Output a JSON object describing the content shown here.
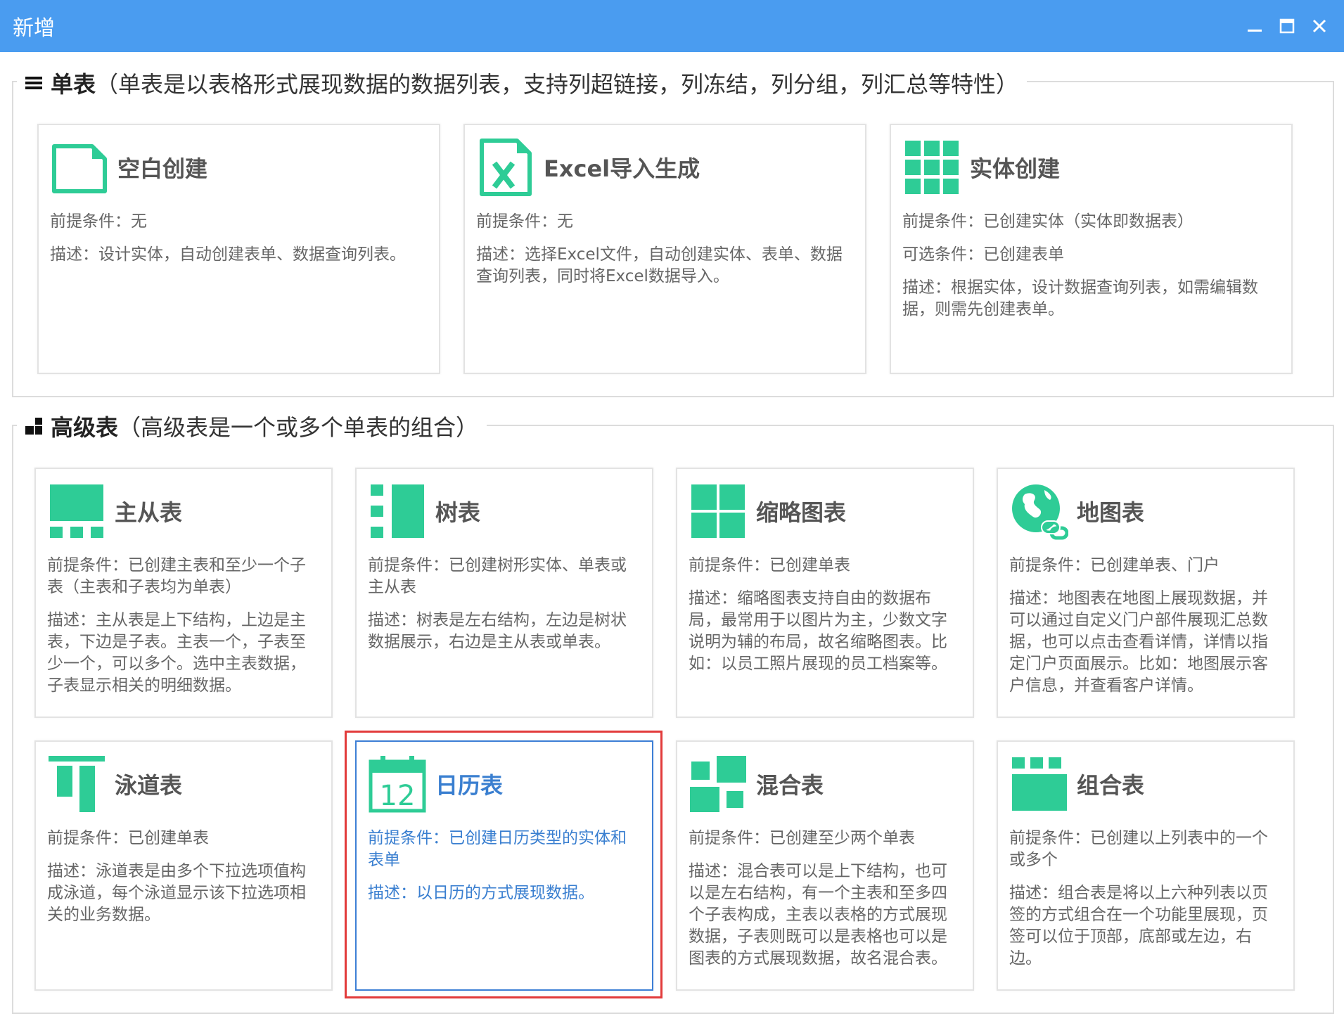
{
  "window": {
    "title": "新增",
    "controls": [
      "minimize-icon",
      "maximize-icon",
      "close-icon"
    ]
  },
  "colors": {
    "titlebar": "#4a9cf0",
    "accent_green": "#2ecc96",
    "selected_blue": "#3a7fd0",
    "selection_red": "#e23b3b"
  },
  "single_table": {
    "name": "单表",
    "desc": "（单表是以表格形式展现数据的数据列表，支持列超链接，列冻结，列分组，列汇总等特性）",
    "icon": "list-icon",
    "cards": [
      {
        "icon": "blank-doc-icon",
        "title": "空白创建",
        "lines": [
          "前提条件：无",
          "描述：设计实体，自动创建表单、数据查询列表。"
        ]
      },
      {
        "icon": "excel-icon",
        "title": "Excel导入生成",
        "lines": [
          "前提条件：无",
          "描述：选择Excel文件，自动创建实体、表单、数据查询列表，同时将Excel数据导入。"
        ]
      },
      {
        "icon": "grid-icon",
        "title": "实体创建",
        "lines": [
          "前提条件：已创建实体（实体即数据表）",
          "可选条件：已创建表单",
          "描述：根据实体，设计数据查询列表，如需编辑数据，则需先创建表单。"
        ]
      }
    ]
  },
  "advanced_table": {
    "name": "高级表",
    "desc": "（高级表是一个或多个单表的组合）",
    "icon": "blocks-icon",
    "cards": [
      {
        "icon": "master-detail-icon",
        "title": "主从表",
        "lines": [
          "前提条件：已创建主表和至少一个子表（主表和子表均为单表）",
          "描述：主从表是上下结构，上边是主表，下边是子表。主表一个，子表至少一个，可以多个。选中主表数据，子表显示相关的明细数据。"
        ]
      },
      {
        "icon": "tree-icon",
        "title": "树表",
        "lines": [
          "前提条件：已创建树形实体、单表或主从表",
          "描述：树表是左右结构，左边是树状数据展示，右边是主从表或单表。"
        ]
      },
      {
        "icon": "thumbnail-icon",
        "title": "缩略图表",
        "lines": [
          "前提条件：已创建单表",
          "描述：缩略图表支持自由的数据布局，最常用于以图片为主，少数文字说明为辅的布局，故名缩略图表。比如：以员工照片展现的员工档案等。"
        ]
      },
      {
        "icon": "map-globe-icon",
        "title": "地图表",
        "lines": [
          "前提条件：已创建单表、门户",
          "描述：地图表在地图上展现数据，并可以通过自定义门户部件展现汇总数据，也可以点击查看详情，详情以指定门户页面展示。比如：地图展示客户信息，并查看客户详情。"
        ]
      },
      {
        "icon": "swimlane-icon",
        "title": "泳道表",
        "lines": [
          "前提条件：已创建单表",
          "描述：泳道表是由多个下拉选项值构成泳道，每个泳道显示该下拉选项相关的业务数据。"
        ]
      },
      {
        "icon": "calendar-icon",
        "title": "日历表",
        "calendar_day": "12",
        "selected": true,
        "lines": [
          "前提条件：已创建日历类型的实体和表单",
          "描述：以日历的方式展现数据。"
        ]
      },
      {
        "icon": "mixed-icon",
        "title": "混合表",
        "lines": [
          "前提条件：已创建至少两个单表",
          "描述：混合表可以是上下结构，也可以是左右结构，有一个主表和至多四个子表构成，主表以表格的方式展现数据，子表则既可以是表格也可以是图表的方式展现数据，故名混合表。"
        ]
      },
      {
        "icon": "combo-icon",
        "title": "组合表",
        "lines": [
          "前提条件：已创建以上列表中的一个或多个",
          "描述：组合表是将以上六种列表以页签的方式组合在一个功能里展现，页签可以位于顶部，底部或左边，右边。"
        ]
      }
    ]
  }
}
